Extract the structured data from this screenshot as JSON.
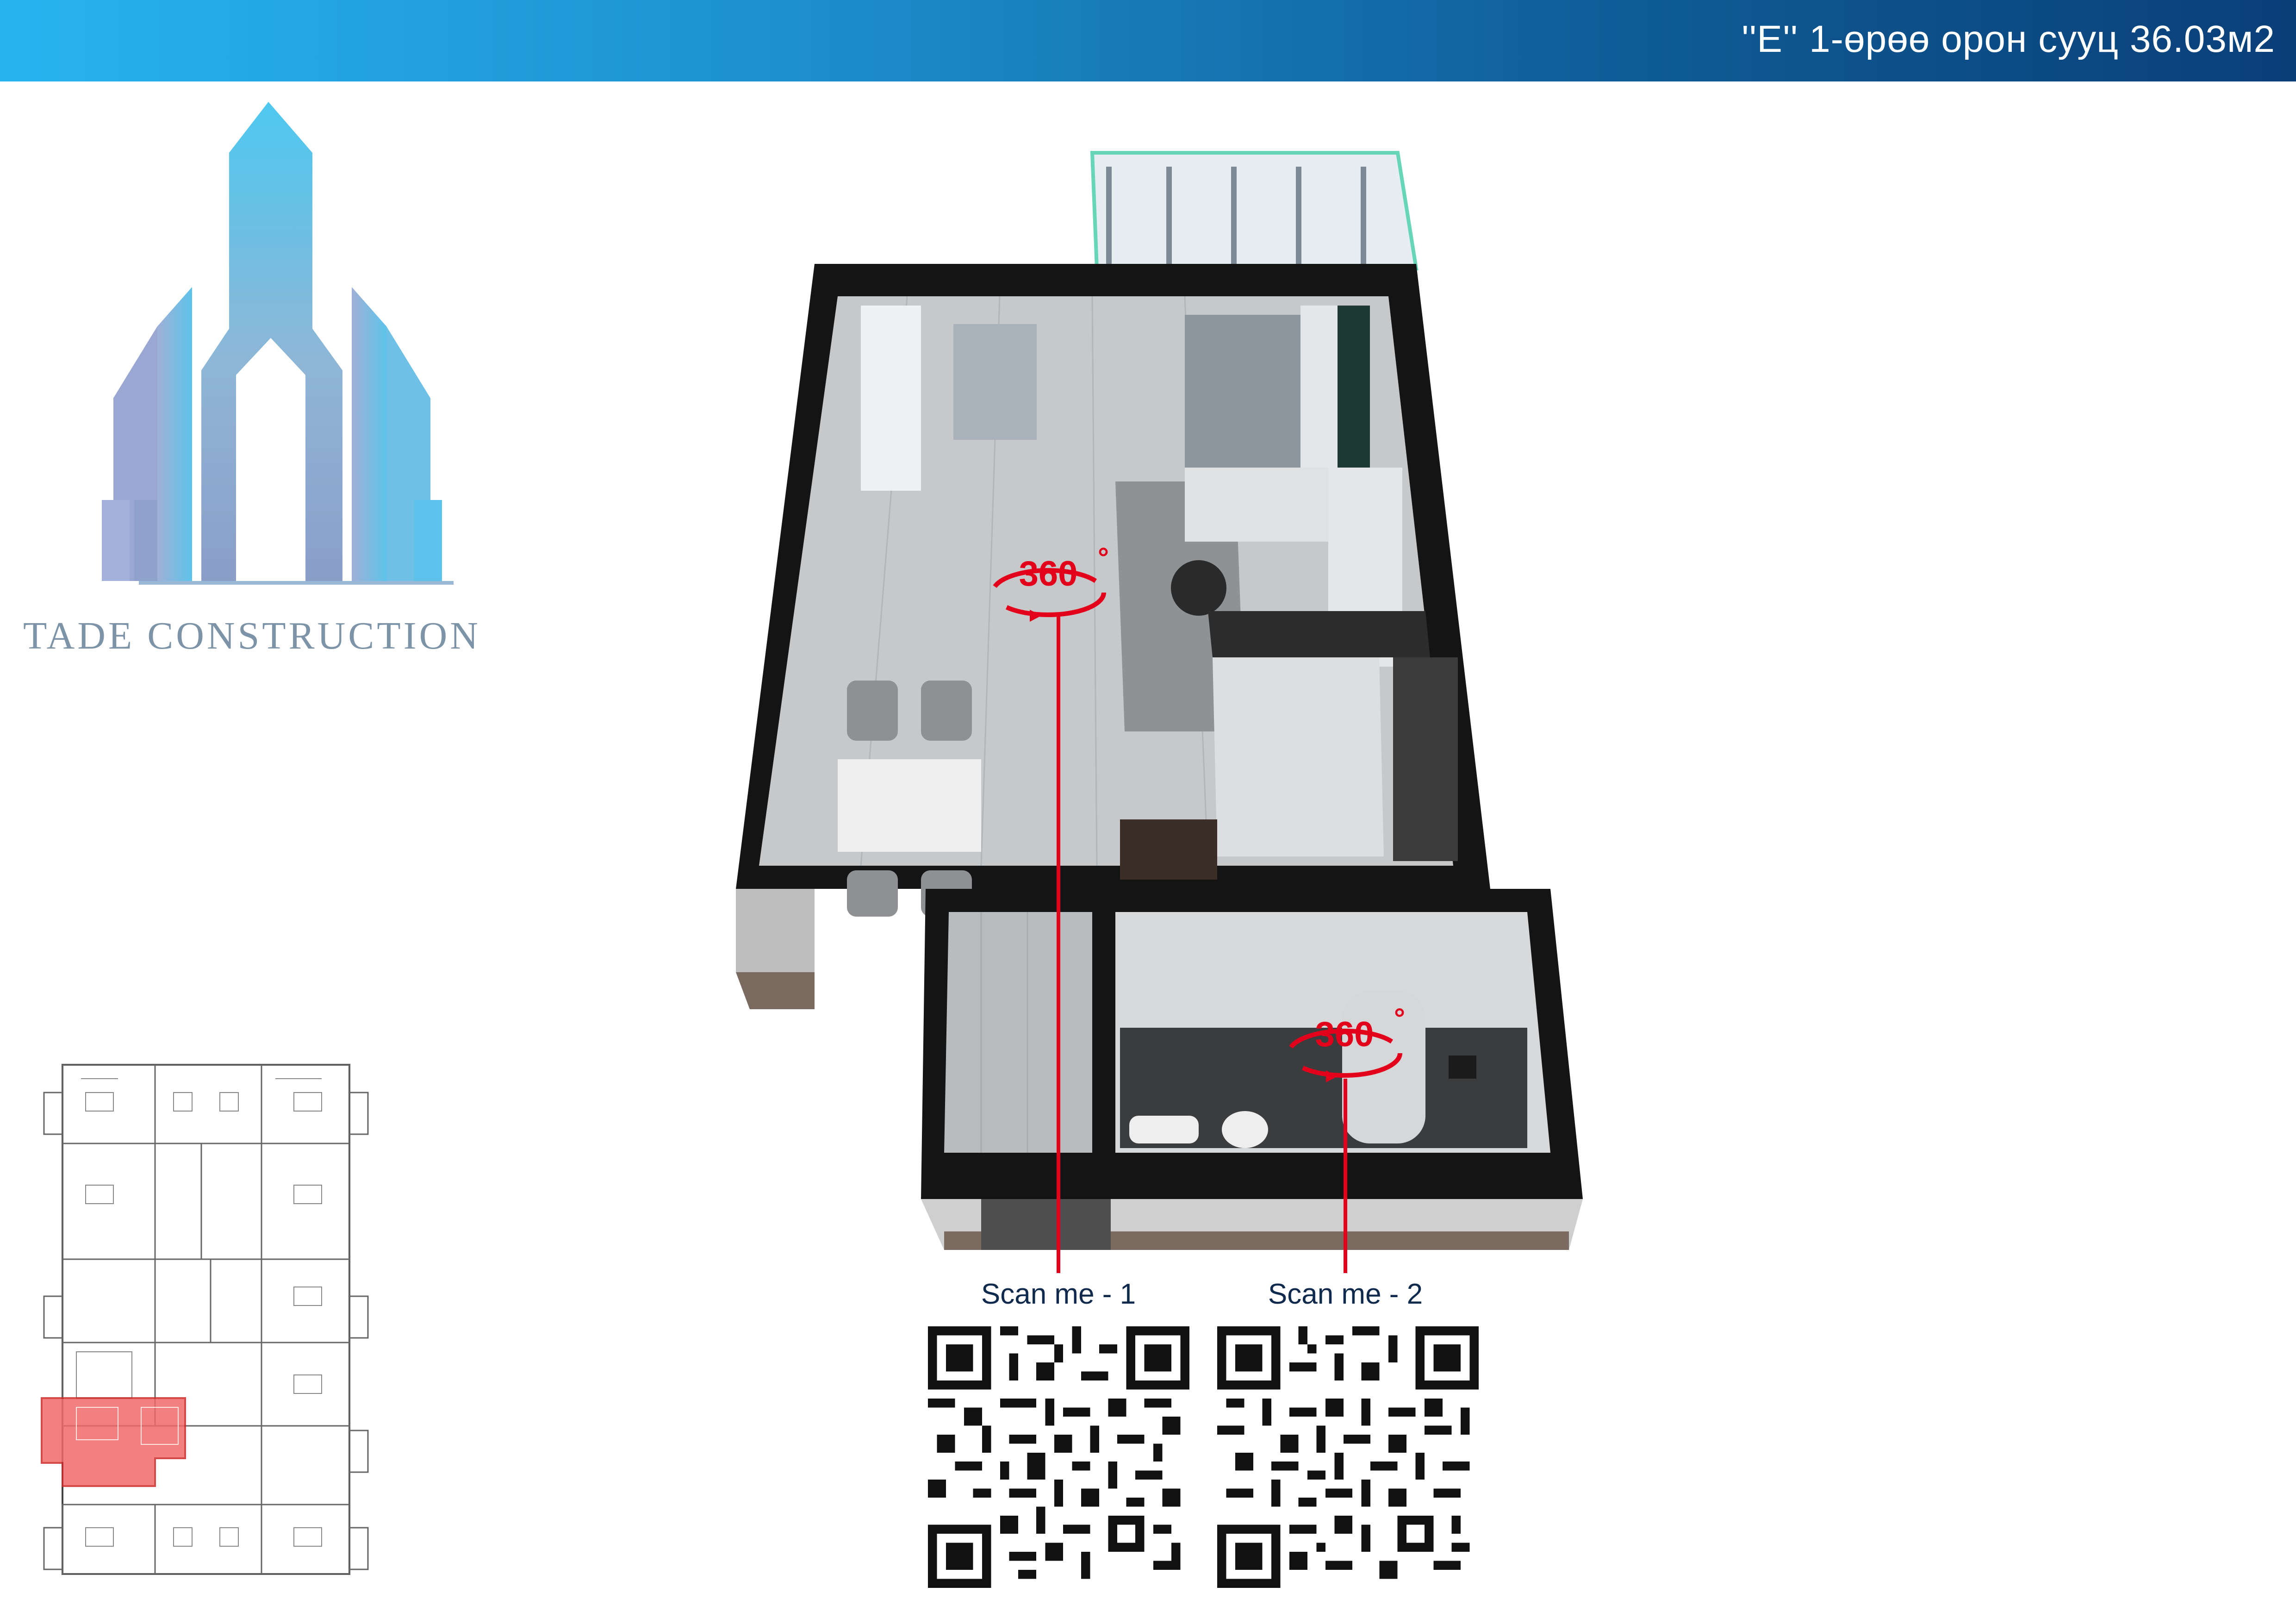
{
  "header": {
    "title": "''E'' 1-өрөө орон сууц 36.03м2"
  },
  "brand": {
    "name": "TADE CONSTRUCTION"
  },
  "panorama_markers": [
    {
      "label": "360",
      "degree_symbol": "°",
      "icon": "panorama-360-icon"
    },
    {
      "label": "360",
      "degree_symbol": "°",
      "icon": "panorama-360-icon"
    }
  ],
  "scan": [
    {
      "label": "Scan me - 1",
      "icon": "qr-code"
    },
    {
      "label": "Scan me - 2",
      "icon": "qr-code"
    }
  ],
  "colors": {
    "header_start": "#27b4ef",
    "header_end": "#0a3f78",
    "accent_red": "#e3001b",
    "highlight_unit": "#f06a6a",
    "scan_text": "#0f2a4d"
  }
}
